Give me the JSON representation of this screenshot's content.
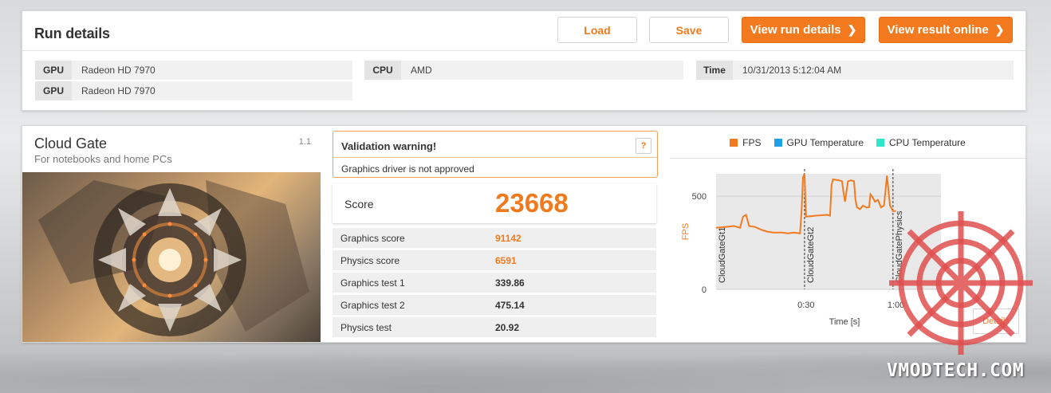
{
  "run": {
    "title": "Run details",
    "load_label": "Load",
    "save_label": "Save",
    "view_run_label": "View run details",
    "view_online_label": "View result online",
    "gpu1_label": "GPU",
    "gpu1_value": "Radeon HD 7970",
    "gpu2_label": "GPU",
    "gpu2_value": "Radeon HD 7970",
    "cpu_label": "CPU",
    "cpu_value": "AMD",
    "time_label": "Time",
    "time_value": "10/31/2013 5:12:04 AM"
  },
  "benchmark": {
    "title": "Cloud Gate",
    "subtitle": "For notebooks and home PCs",
    "version": "1.1"
  },
  "validation": {
    "title": "Validation warning!",
    "help": "?",
    "message": "Graphics driver is not approved"
  },
  "score": {
    "label": "Score",
    "value": "23668"
  },
  "stats": [
    {
      "label": "Graphics score",
      "value": "91142",
      "highlight": true
    },
    {
      "label": "Physics score",
      "value": "6591",
      "highlight": true
    },
    {
      "label": "Graphics test 1",
      "value": "339.86",
      "highlight": false
    },
    {
      "label": "Graphics test 2",
      "value": "475.14",
      "highlight": false
    },
    {
      "label": "Physics test",
      "value": "20.92",
      "highlight": false
    }
  ],
  "colors": {
    "accent": "#f47a20",
    "fps": "#f47a20",
    "gpu_temp": "#1ea0e6",
    "cpu_temp": "#2ee6c8"
  },
  "chart_legend": {
    "fps": "FPS",
    "gpu": "GPU Temperature",
    "cpu": "CPU Temperature"
  },
  "details_label": "Details",
  "watermark": "VMODTECH.COM",
  "chart_data": {
    "type": "line",
    "ylabel": "FPS",
    "xlabel": "Time [s]",
    "yticks": [
      "0",
      "500"
    ],
    "xticks": [
      "0:30",
      "1:00"
    ],
    "ylim": [
      0,
      620
    ],
    "xlim": [
      0,
      75
    ],
    "markers": [
      {
        "x": 0,
        "label": "CloudGateGt1"
      },
      {
        "x": 29.5,
        "label": "CloudGateGt2"
      },
      {
        "x": 59,
        "label": "CloudGatePhysics"
      }
    ],
    "series": [
      {
        "name": "FPS",
        "values": [
          [
            0,
            330
          ],
          [
            3,
            335
          ],
          [
            6,
            340
          ],
          [
            8,
            330
          ],
          [
            9,
            390
          ],
          [
            10,
            400
          ],
          [
            11,
            340
          ],
          [
            13,
            335
          ],
          [
            15,
            320
          ],
          [
            17,
            310
          ],
          [
            19,
            305
          ],
          [
            22,
            305
          ],
          [
            24,
            300
          ],
          [
            26,
            305
          ],
          [
            28,
            300
          ],
          [
            28.5,
            420
          ],
          [
            29,
            600
          ],
          [
            29.5,
            620
          ],
          [
            30,
            390
          ],
          [
            33,
            395
          ],
          [
            37,
            400
          ],
          [
            38,
            395
          ],
          [
            38.5,
            560
          ],
          [
            39,
            590
          ],
          [
            41,
            585
          ],
          [
            42,
            580
          ],
          [
            42.5,
            520
          ],
          [
            43,
            470
          ],
          [
            44,
            580
          ],
          [
            45,
            585
          ],
          [
            46,
            580
          ],
          [
            46.5,
            480
          ],
          [
            47,
            440
          ],
          [
            48,
            430
          ],
          [
            49,
            450
          ],
          [
            50,
            440
          ],
          [
            51,
            440
          ],
          [
            51.5,
            510
          ],
          [
            52,
            500
          ],
          [
            53,
            470
          ],
          [
            54,
            480
          ],
          [
            55,
            440
          ],
          [
            56,
            450
          ],
          [
            57,
            610
          ],
          [
            58,
            450
          ],
          [
            59,
            420
          ],
          [
            60,
            420
          ]
        ]
      }
    ]
  }
}
